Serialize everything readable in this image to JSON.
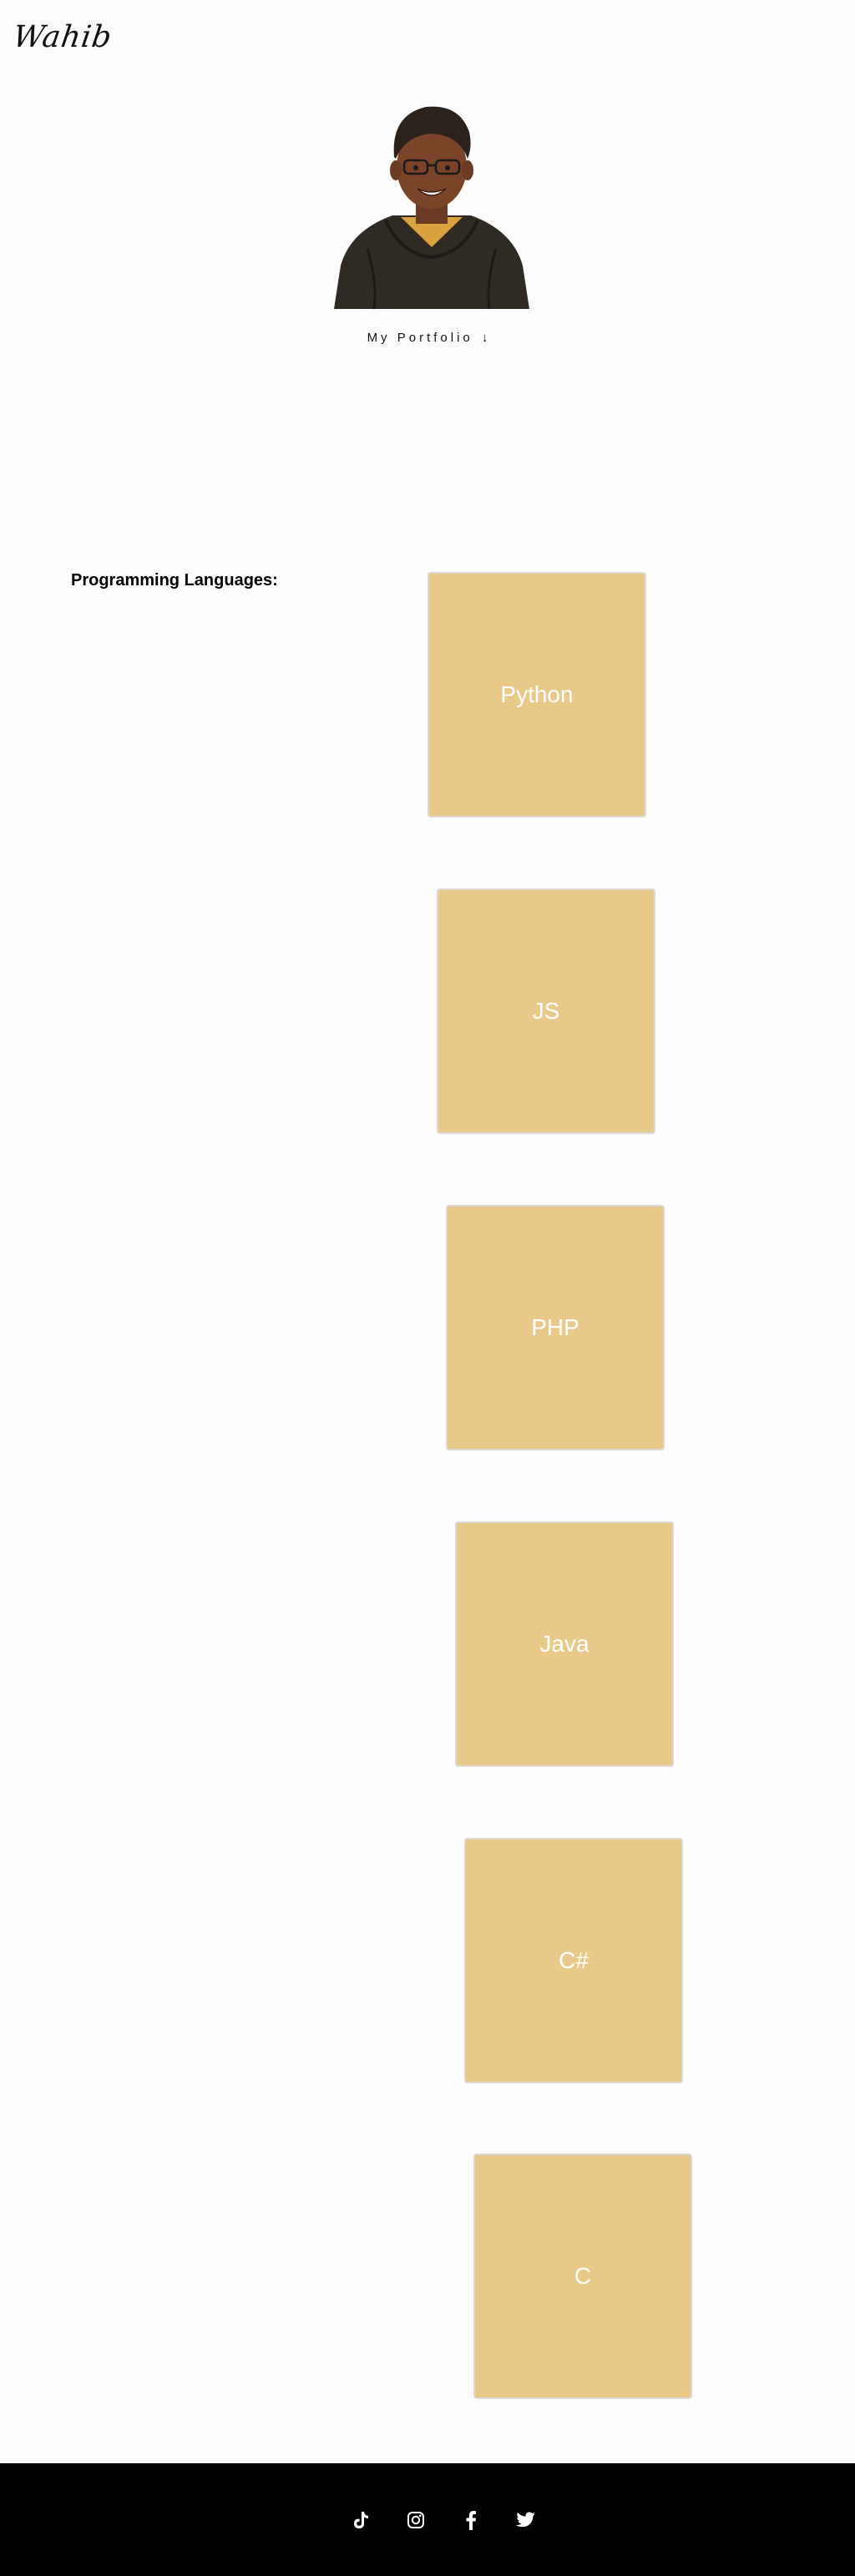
{
  "header": {
    "logo_text": "Wahib"
  },
  "hero": {
    "portfolio_link_label": "My Portfolio",
    "portfolio_link_arrow": "↓"
  },
  "skills": {
    "heading": "Programming Languages:",
    "languages": [
      "Python",
      "JS",
      "PHP",
      "Java",
      "C#",
      "C"
    ],
    "card_color": "#e8c98a"
  },
  "footer": {
    "background": "#000000",
    "social_icons": [
      "tiktok-icon",
      "instagram-icon",
      "facebook-icon",
      "twitter-icon"
    ]
  }
}
